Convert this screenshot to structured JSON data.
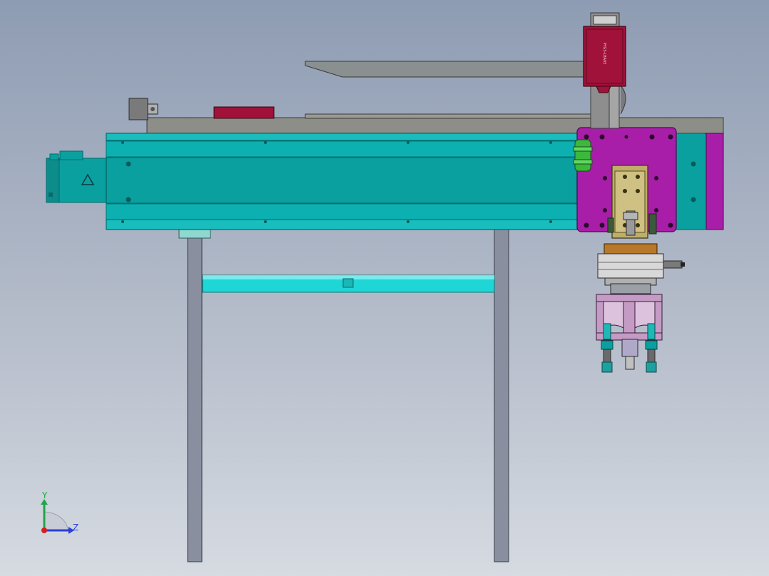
{
  "viewport": {
    "background_top": "#8e9cb3",
    "background_bottom": "#d6dbe2"
  },
  "triad": {
    "y_label": "Y",
    "z_label": "Z",
    "y_color": "#1fa64a",
    "z_color": "#2a3fd6",
    "origin_color": "#d02020"
  },
  "colors": {
    "actuator_body": "#0aa0a0",
    "actuator_edge": "#006b6b",
    "carriage_plate": "#a81ea8",
    "steel": "#8a8a8a",
    "motor_box": "#a0123a",
    "crossbar": "#1fd6d6",
    "slide_block": "#bfae6a"
  },
  "motor": {
    "warning_icon": "warning-triangle-icon"
  },
  "label_plate": {
    "text": "PYGS-LBA05"
  }
}
